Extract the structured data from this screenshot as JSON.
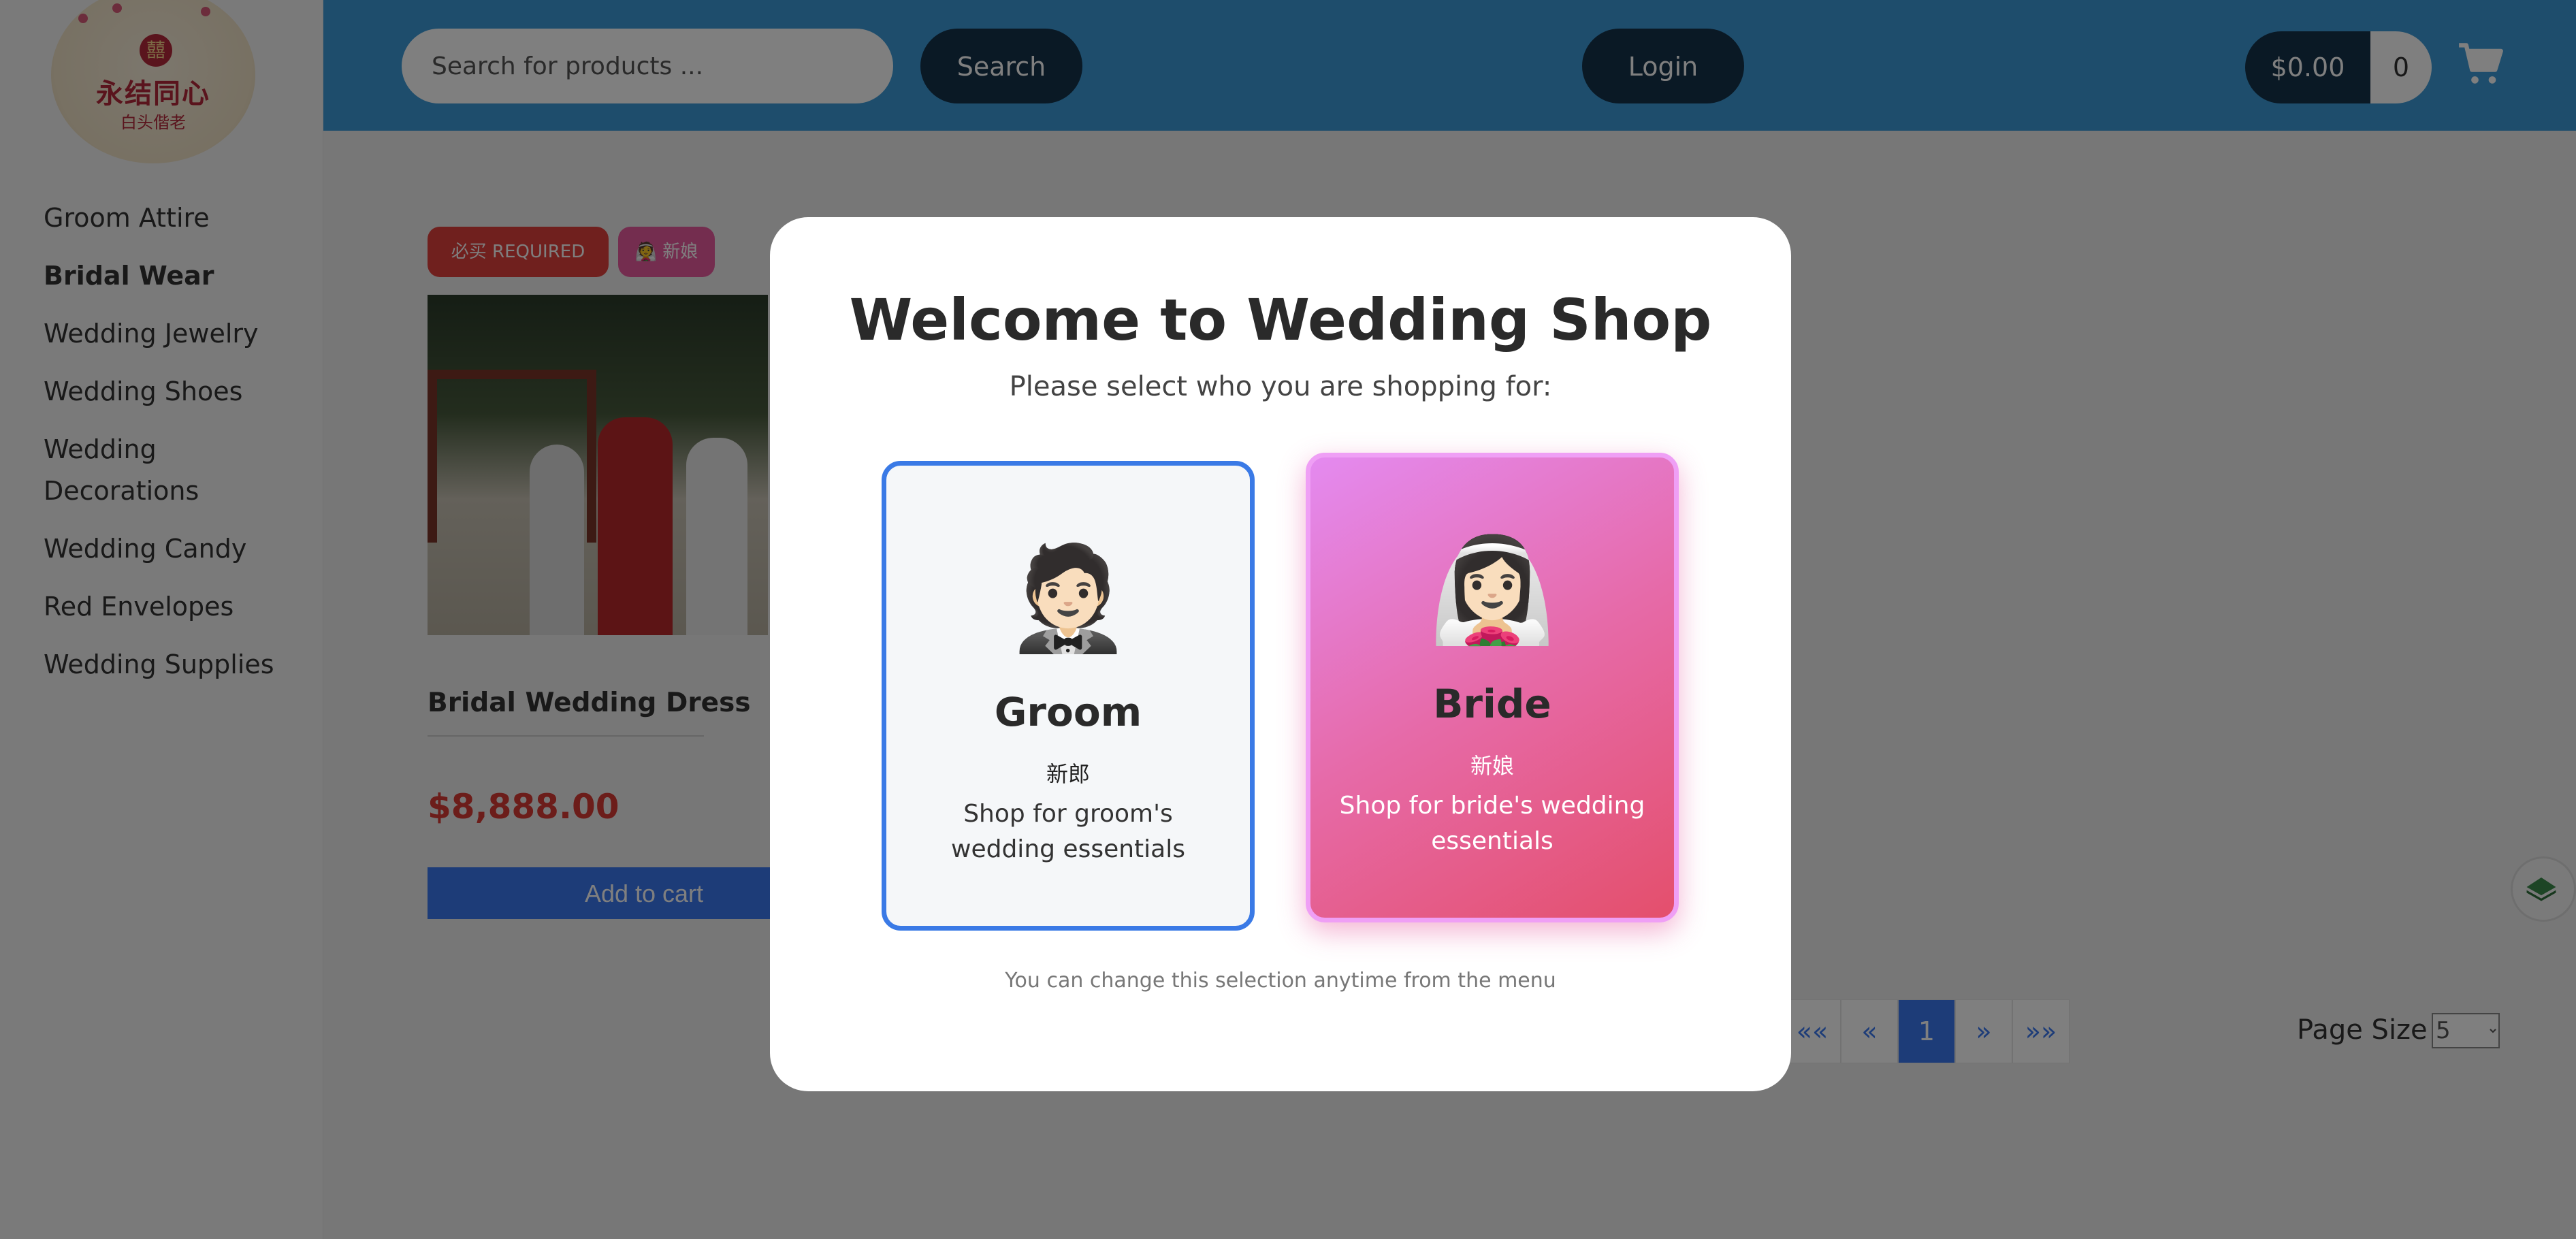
{
  "logo": {
    "seal_text": "囍",
    "line1": "永结同心",
    "line2": "白头偕老"
  },
  "sidebar": {
    "categories": [
      {
        "label": "Groom Attire"
      },
      {
        "label": "Bridal Wear"
      },
      {
        "label": "Wedding Jewelry"
      },
      {
        "label": "Wedding Shoes"
      },
      {
        "label": "Wedding Decorations"
      },
      {
        "label": "Wedding Candy"
      },
      {
        "label": "Red Envelopes"
      },
      {
        "label": "Wedding Supplies"
      }
    ],
    "active_category": "Bridal Wear"
  },
  "header": {
    "search_placeholder": "Search for products ...",
    "search_button": "Search",
    "login_button": "Login",
    "cart_total": "$0.00",
    "cart_count": "0",
    "cart_icon": "shopping-cart-icon"
  },
  "product": {
    "badge_required": "必买 REQUIRED",
    "badge_bride": "👰 新娘",
    "title": "Bridal Wedding Dress",
    "price": "$8,888.00",
    "add_to_cart": "Add to cart"
  },
  "pagination": {
    "first": "««",
    "prev": "«",
    "current": "1",
    "next": "»",
    "last": "»»",
    "page_size_label": "Page Size",
    "page_size_value": "5"
  },
  "modal": {
    "title": "Welcome to Wedding Shop",
    "subtitle": "Please select who you are shopping for:",
    "groom": {
      "emoji": "🤵🏻",
      "name": "Groom",
      "chinese": "新郎",
      "description": "Shop for groom's wedding essentials"
    },
    "bride": {
      "emoji": "👰🏻‍♀️",
      "name": "Bride",
      "chinese": "新娘",
      "description": "Shop for bride's wedding essentials"
    },
    "note": "You can change this selection anytime from the menu"
  },
  "colors": {
    "header_blue": "#3d9bd8",
    "dark_button": "#14324a",
    "accent_blue": "#3a78f0",
    "price_red": "#d93a34",
    "bride_pink": "#e66aa8"
  }
}
